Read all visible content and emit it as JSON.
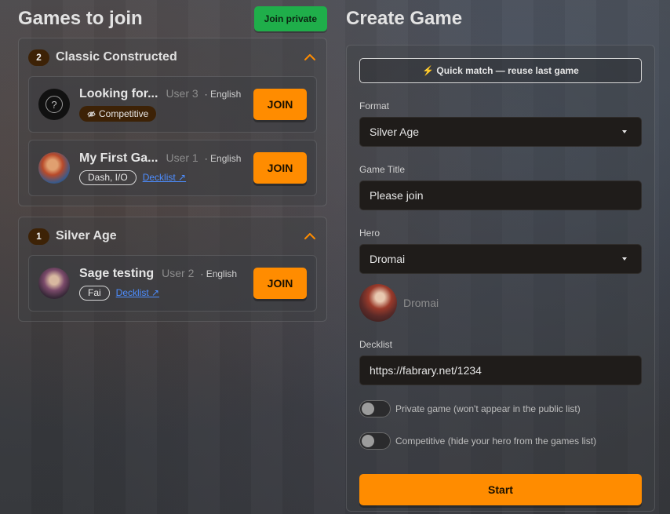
{
  "games_panel": {
    "title": "Games to join",
    "join_private_label": "Join private",
    "groups": [
      {
        "count": "2",
        "title": "Classic Constructed",
        "games": [
          {
            "title": "Looking for...",
            "user": "User 3",
            "language": "· English",
            "competitive_tag": "Competitive",
            "join_label": "JOIN",
            "avatar": "unknown-hero-icon"
          },
          {
            "title": "My First Ga...",
            "user": "User 1",
            "language": "· English",
            "hero_tag": "Dash, I/O",
            "decklist_label": "Decklist ↗",
            "join_label": "JOIN",
            "avatar": "hero-portrait"
          }
        ]
      },
      {
        "count": "1",
        "title": "Silver Age",
        "games": [
          {
            "title": "Sage testing",
            "user": "User 2",
            "language": "· English",
            "hero_tag": "Fai",
            "decklist_label": "Decklist ↗",
            "join_label": "JOIN",
            "avatar": "hero-portrait"
          }
        ]
      }
    ]
  },
  "create_panel": {
    "title": "Create Game",
    "quick_match_label": "⚡ Quick match — reuse last game",
    "format": {
      "label": "Format",
      "value": "Silver Age"
    },
    "game_title": {
      "label": "Game Title",
      "value": "Please join"
    },
    "hero": {
      "label": "Hero",
      "value": "Dromai",
      "preview_name": "Dromai"
    },
    "decklist": {
      "label": "Decklist",
      "value": "https://fabrary.net/1234"
    },
    "private_toggle": {
      "label": "Private game (won't appear in the public list)",
      "on": false
    },
    "competitive_toggle": {
      "label": "Competitive (hide your hero from the games list)",
      "on": false
    },
    "start_label": "Start"
  },
  "colors": {
    "accent": "#ff8c00",
    "join_private": "#1fae4a",
    "link": "#4d8dff",
    "badge": "#3d2206"
  }
}
